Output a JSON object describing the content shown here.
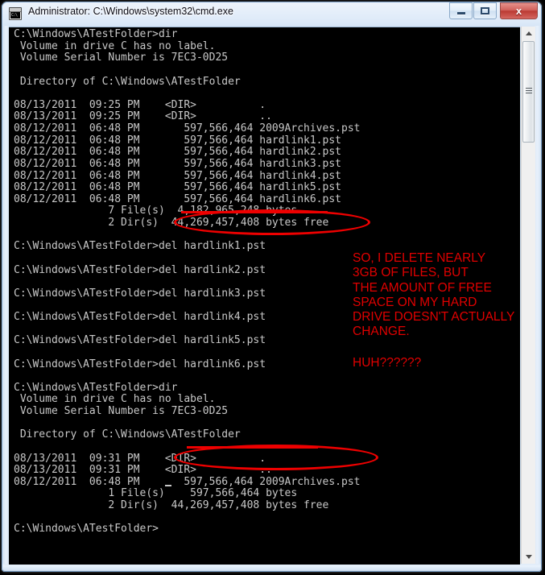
{
  "window": {
    "title": "Administrator: C:\\Windows\\system32\\cmd.exe",
    "icon_text": "C:\\",
    "icon_name": "cmd-icon",
    "buttons": {
      "minimize": "—",
      "maximize": "❐",
      "close": "x"
    }
  },
  "console": {
    "text": "C:\\Windows\\ATestFolder>dir\n Volume in drive C has no label.\n Volume Serial Number is 7EC3-0D25\n\n Directory of C:\\Windows\\ATestFolder\n\n08/13/2011  09:25 PM    <DIR>          .\n08/13/2011  09:25 PM    <DIR>          ..\n08/12/2011  06:48 PM       597,566,464 2009Archives.pst\n08/12/2011  06:48 PM       597,566,464 hardlink1.pst\n08/12/2011  06:48 PM       597,566,464 hardlink2.pst\n08/12/2011  06:48 PM       597,566,464 hardlink3.pst\n08/12/2011  06:48 PM       597,566,464 hardlink4.pst\n08/12/2011  06:48 PM       597,566,464 hardlink5.pst\n08/12/2011  06:48 PM       597,566,464 hardlink6.pst\n               7 File(s)  4,182,965,248 bytes\n               2 Dir(s)  44,269,457,408 bytes free\n\nC:\\Windows\\ATestFolder>del hardlink1.pst\n\nC:\\Windows\\ATestFolder>del hardlink2.pst\n\nC:\\Windows\\ATestFolder>del hardlink3.pst\n\nC:\\Windows\\ATestFolder>del hardlink4.pst\n\nC:\\Windows\\ATestFolder>del hardlink5.pst\n\nC:\\Windows\\ATestFolder>del hardlink6.pst\n\nC:\\Windows\\ATestFolder>dir\n Volume in drive C has no label.\n Volume Serial Number is 7EC3-0D25\n\n Directory of C:\\Windows\\ATestFolder\n\n08/13/2011  09:31 PM    <DIR>          .\n08/13/2011  09:31 PM    <DIR>          ..\n08/12/2011  06:48 PM       597,566,464 2009Archives.pst\n               1 File(s)    597,566,464 bytes\n               2 Dir(s)  44,269,457,408 bytes free\n\nC:\\Windows\\ATestFolder>",
    "prompt": "C:\\Windows\\ATestFolder>",
    "command_dir": "dir",
    "volume_label_line": " Volume in drive C has no label.",
    "volume_serial": "7EC3-0D25",
    "directory_path": "C:\\Windows\\ATestFolder",
    "first_listing": {
      "entries": [
        {
          "date": "08/13/2011",
          "time": "09:25 PM",
          "type": "<DIR>",
          "size": "",
          "name": "."
        },
        {
          "date": "08/13/2011",
          "time": "09:25 PM",
          "type": "<DIR>",
          "size": "",
          "name": ".."
        },
        {
          "date": "08/12/2011",
          "time": "06:48 PM",
          "type": "",
          "size": "597,566,464",
          "name": "2009Archives.pst"
        },
        {
          "date": "08/12/2011",
          "time": "06:48 PM",
          "type": "",
          "size": "597,566,464",
          "name": "hardlink1.pst"
        },
        {
          "date": "08/12/2011",
          "time": "06:48 PM",
          "type": "",
          "size": "597,566,464",
          "name": "hardlink2.pst"
        },
        {
          "date": "08/12/2011",
          "time": "06:48 PM",
          "type": "",
          "size": "597,566,464",
          "name": "hardlink3.pst"
        },
        {
          "date": "08/12/2011",
          "time": "06:48 PM",
          "type": "",
          "size": "597,566,464",
          "name": "hardlink4.pst"
        },
        {
          "date": "08/12/2011",
          "time": "06:48 PM",
          "type": "",
          "size": "597,566,464",
          "name": "hardlink5.pst"
        },
        {
          "date": "08/12/2011",
          "time": "06:48 PM",
          "type": "",
          "size": "597,566,464",
          "name": "hardlink6.pst"
        }
      ],
      "file_count": "7 File(s)",
      "total_bytes": "4,182,965,248 bytes",
      "dir_count": "2 Dir(s)",
      "bytes_free": "44,269,457,408 bytes free"
    },
    "delete_commands": [
      "del hardlink1.pst",
      "del hardlink2.pst",
      "del hardlink3.pst",
      "del hardlink4.pst",
      "del hardlink5.pst",
      "del hardlink6.pst"
    ],
    "second_listing": {
      "entries": [
        {
          "date": "08/13/2011",
          "time": "09:31 PM",
          "type": "<DIR>",
          "size": "",
          "name": "."
        },
        {
          "date": "08/13/2011",
          "time": "09:31 PM",
          "type": "<DIR>",
          "size": "",
          "name": ".."
        },
        {
          "date": "08/12/2011",
          "time": "06:48 PM",
          "type": "",
          "size": "597,566,464",
          "name": "2009Archives.pst"
        }
      ],
      "file_count": "1 File(s)",
      "total_bytes": "597,566,464 bytes",
      "dir_count": "2 Dir(s)",
      "bytes_free": "44,269,457,408 bytes free"
    }
  },
  "annotations": {
    "main_text": "SO, I DELETE NEARLY\n3GB OF FILES, BUT\nTHE AMOUNT OF FREE\nSPACE ON MY HARD\nDRIVE DOESN'T ACTUALLY\nCHANGE.",
    "huh_text": "HUH??????",
    "color": "#e00000",
    "highlighted_values": [
      "44,269,457,408 bytes free",
      "44,269,457,408 bytes free"
    ],
    "struck_values": [
      "4,182,965,248 bytes",
      "597,566,464 bytes"
    ]
  },
  "scrollbar": {
    "up_arrow": "▲",
    "down_arrow": "▼"
  }
}
